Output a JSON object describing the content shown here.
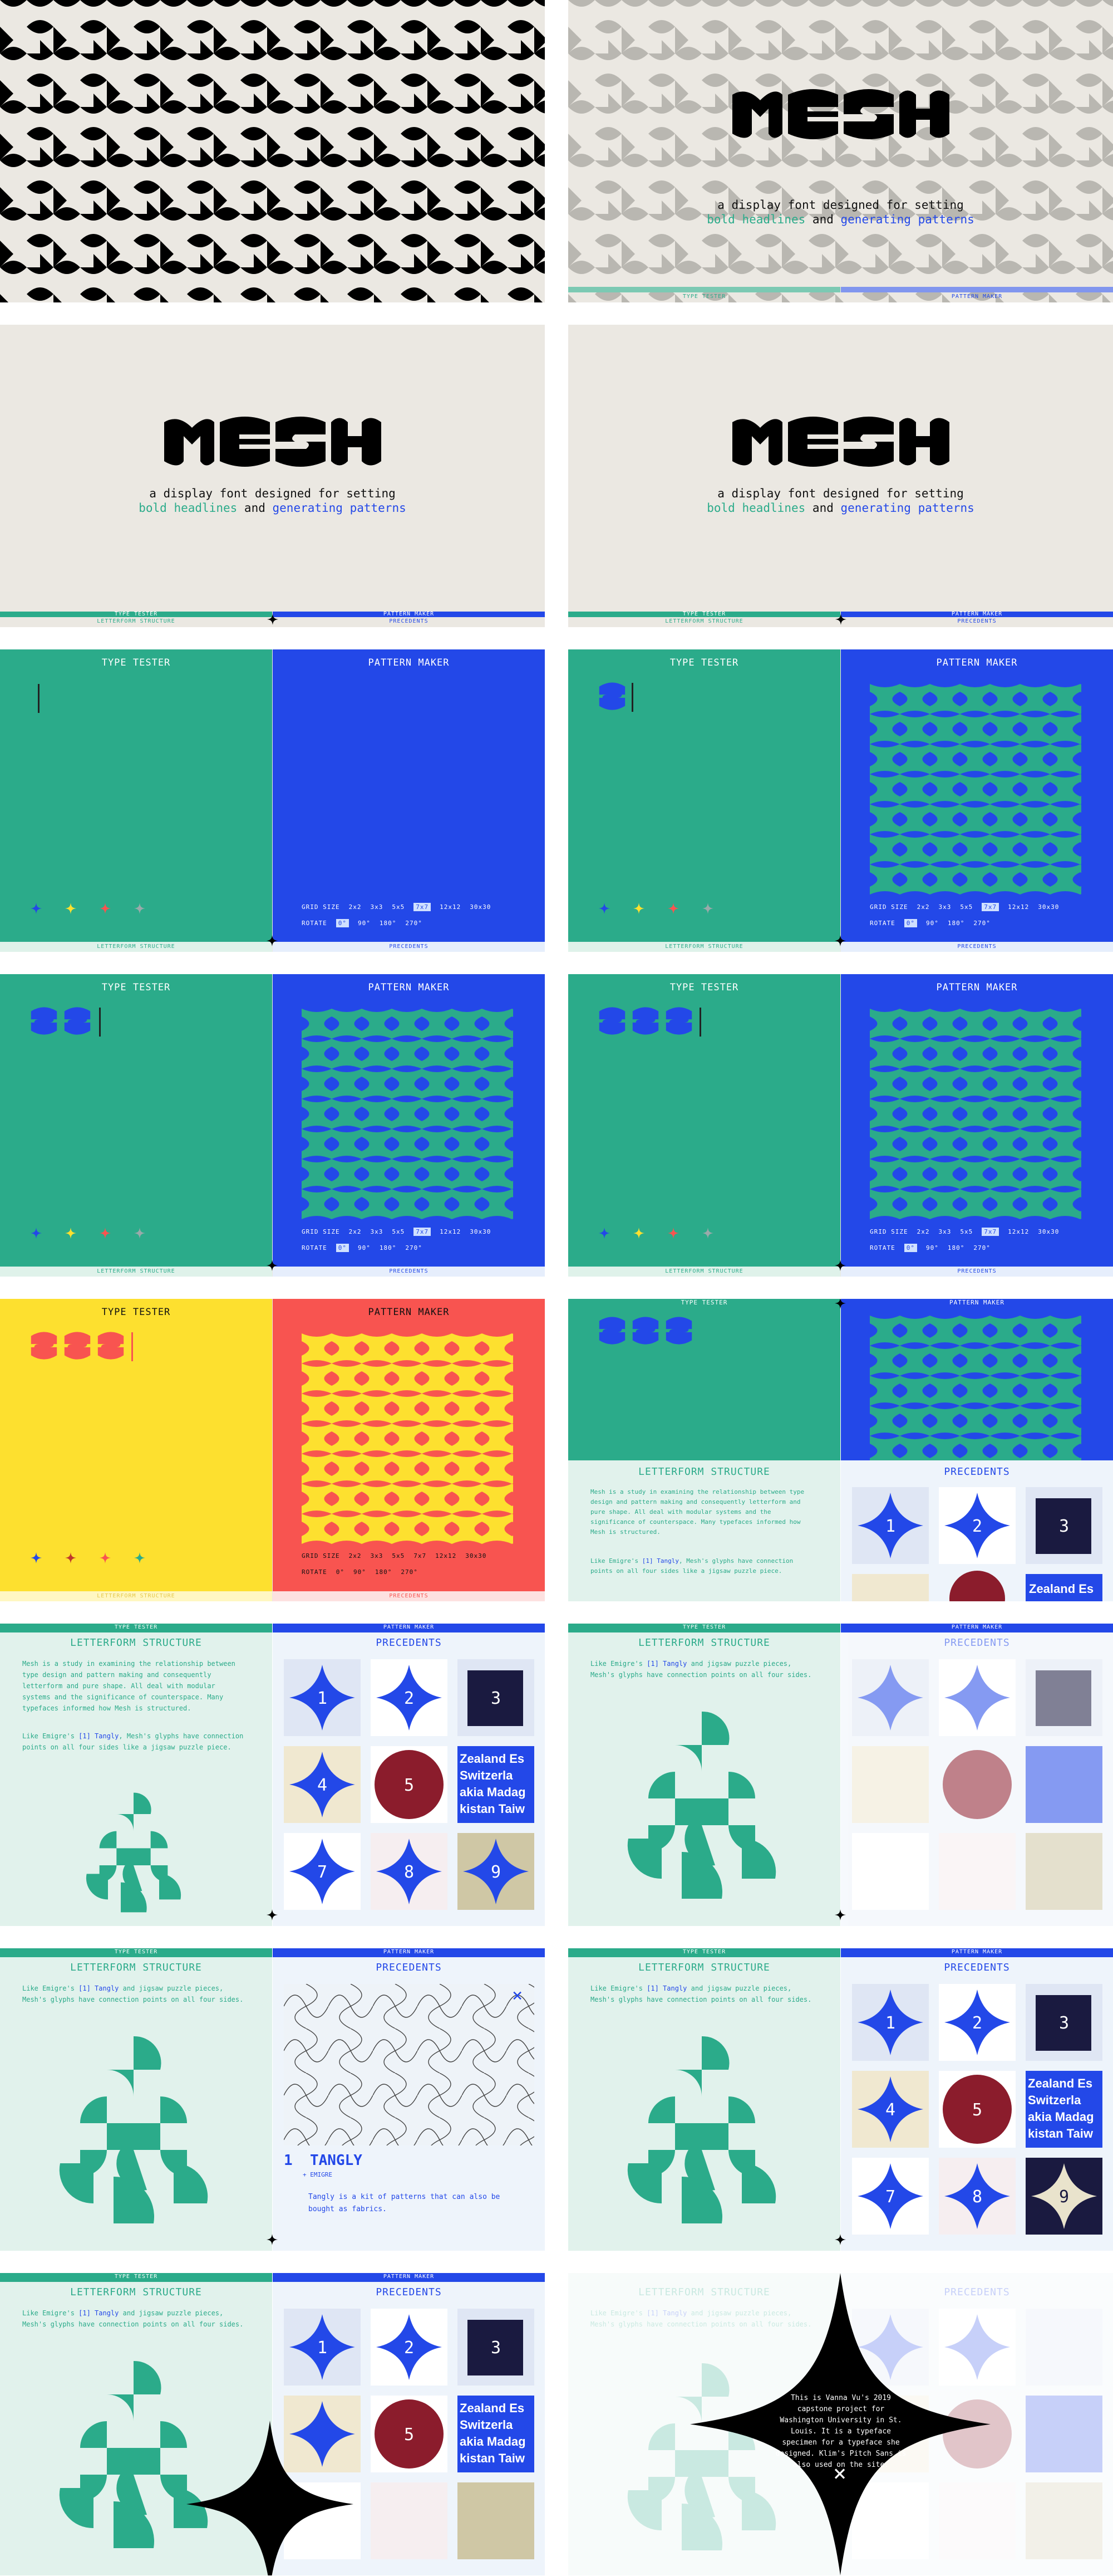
{
  "hero": {
    "tagline_line1": "a display font designed for setting",
    "tagline_highlight1": "bold headlines",
    "tagline_and": "and",
    "tagline_highlight2": "generating patterns"
  },
  "nav": {
    "type_tester": "TYPE TESTER",
    "pattern_maker": "PATTERN MAKER",
    "letterform_structure": "LETTERFORM STRUCTURE",
    "precedents": "PRECEDENTS"
  },
  "tester": {
    "samples": [
      "S",
      "SU",
      "SUN",
      "SUN",
      "SUN"
    ]
  },
  "pattern_controls": {
    "grid_size_label": "GRID SIZE",
    "grid_sizes": [
      "2x2",
      "3x3",
      "5x5",
      "7x7",
      "12x12",
      "30x30"
    ],
    "selected_grid": "7x7",
    "rotate_label": "ROTATE",
    "rotations": [
      "0°",
      "90°",
      "180°",
      "270°"
    ],
    "selected_rotation": "0°"
  },
  "letterform": {
    "paragraph1": "Mesh is a study in examining the relationship between type design and pattern making and consequently letterform and pure shape. All deal with modular systems and the significance of counterspace. Many typefaces informed how Mesh is structured.",
    "paragraph2_pre": "Like Emigre's",
    "paragraph2_link": "[1] Tangly",
    "paragraph2_post": ", Mesh's glyphs have connection points on all four sides like a jigsaw puzzle piece.",
    "paragraph3_pre": "Like Emigre's",
    "paragraph3_link": "[1] Tangly",
    "paragraph3_post": "and jigsaw puzzle pieces, Mesh's glyphs have connection points on all four sides."
  },
  "precedent_detail": {
    "number": "1",
    "name": "TANGLY",
    "source": "+ EMIGRE",
    "description": "Tangly is a kit of patterns that can also be bought as fabrics."
  },
  "about": {
    "caption": "This is Vanna Vu's 2019 capstone project for Washington University in St. Louis. It is a typeface specimen for a typeface she designed. Klim's Pitch Sans is also used on the site.",
    "close": "×"
  },
  "colors": {
    "green": "#2bab8a",
    "blue": "#2348e8",
    "yellow": "#fde02f",
    "red": "#f85450",
    "cream": "#ebe8e2",
    "black": "#000000"
  }
}
